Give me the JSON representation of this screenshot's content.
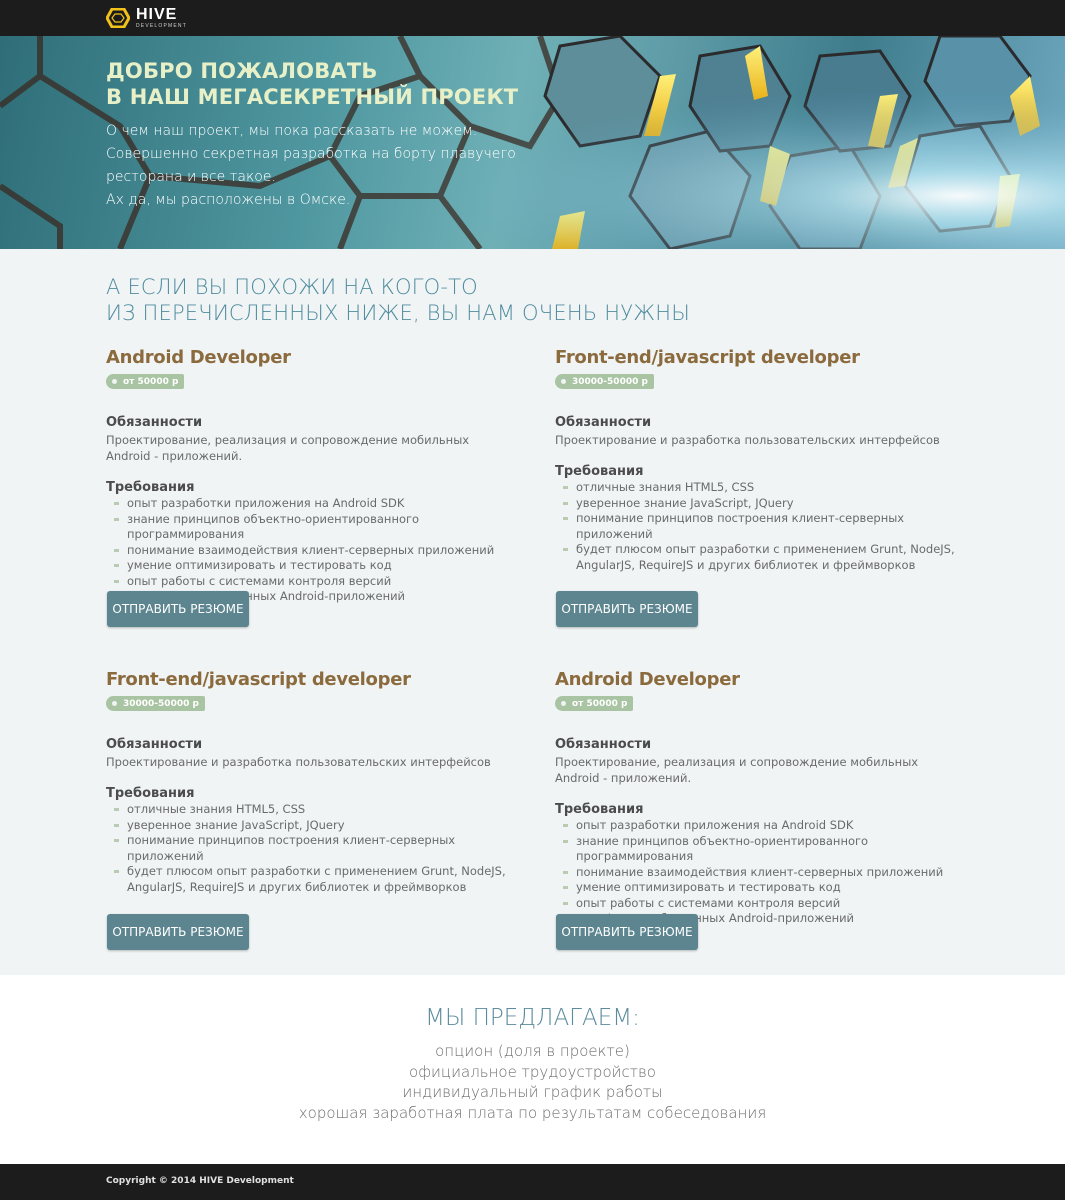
{
  "header": {
    "logo_name": "HIVE",
    "logo_sub": "DEVELOPMENT"
  },
  "hero": {
    "title_line1": "Добро пожаловать",
    "title_line2": "в наш мегасекретный проект",
    "text_line1": "О чем наш проект, мы пока рассказать не можем.",
    "text_line2": "Совершенно секретная разработка на борту плавучего",
    "text_line3": "ресторана и все такое.",
    "text_line4": "Ах да, мы расположены в Омске."
  },
  "vacancies": {
    "title_line1": "А если вы похожи на кого-то",
    "title_line2": "из перечисленных ниже, вы нам очень нужны",
    "cards": [
      {
        "title": "Android Developer",
        "salary": "от 50000 р",
        "duties_heading": "Обязанности",
        "duties": "Проектирование, реализация и сопровождение мобильных Android - приложений.",
        "reqs_heading": "Требования",
        "reqs": [
          "опыт разработки приложения на Android SDK",
          "знание принципов объектно-ориентированного программирования",
          "понимание взаимодействия клиент-серверных приложений",
          "умение оптимизировать и тестировать код",
          "опыт работы с системами контроля версий",
          "портфолио собственных Android-приложений"
        ],
        "button": "Отправить резюме"
      },
      {
        "title": "Front-end/javascript developer",
        "salary": "30000-50000 р",
        "duties_heading": "Обязанности",
        "duties": "Проектирование и разработка пользовательских интерфейсов",
        "reqs_heading": "Требования",
        "reqs": [
          "отличные знания HTML5, CSS",
          "уверенное знание JavaScript, JQuery",
          "понимание принципов построения клиент-серверных приложений",
          "будет плюсом опыт разработки с применением Grunt, NodeJS, AngularJS, RequireJS и других библиотек и фреймворков"
        ],
        "button": "Отправить резюме"
      },
      {
        "title": "Front-end/javascript developer",
        "salary": "30000-50000 р",
        "duties_heading": "Обязанности",
        "duties": "Проектирование и разработка пользовательских интерфейсов",
        "reqs_heading": "Требования",
        "reqs": [
          "отличные знания HTML5, CSS",
          "уверенное знание JavaScript, JQuery",
          "понимание принципов построения клиент-серверных приложений",
          "будет плюсом опыт разработки с применением Grunt, NodeJS, AngularJS, RequireJS и других библиотек и фреймворков"
        ],
        "button": "Отправить резюме"
      },
      {
        "title": "Android Developer",
        "salary": "от 50000 р",
        "duties_heading": "Обязанности",
        "duties": "Проектирование, реализация и сопровождение мобильных Android - приложений.",
        "reqs_heading": "Требования",
        "reqs": [
          "опыт разработки приложения на Android SDK",
          "знание принципов объектно-ориентированного программирования",
          "понимание взаимодействия клиент-серверных приложений",
          "умение оптимизировать и тестировать код",
          "опыт работы с системами контроля версий",
          "портфолио собственных Android-приложений"
        ],
        "button": "Отправить резюме"
      }
    ]
  },
  "offer": {
    "title": "Мы предлагаем:",
    "items": [
      "опцион (доля в проекте)",
      "официальное трудоустройство",
      "индивидуальный график работы",
      "хорошая заработная плата по результатам собеседования"
    ]
  },
  "footer": {
    "copyright": "Copyright © 2014 HIVE Development"
  },
  "colors": {
    "accent_brown": "#8b6b3e",
    "accent_teal": "#4f8c9e",
    "button": "#5c8590",
    "salary_badge": "#a9c4a3",
    "logo_yellow": "#f2c21a"
  }
}
